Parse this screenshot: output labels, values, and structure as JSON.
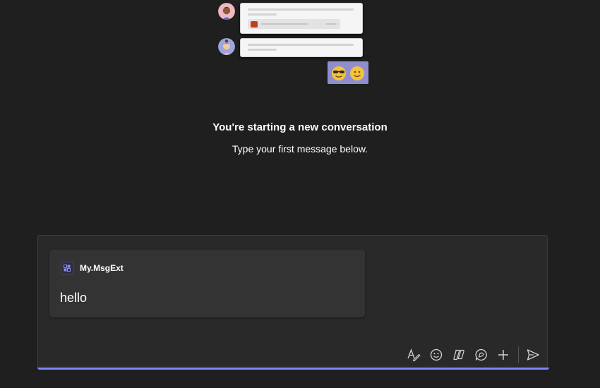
{
  "empty_state": {
    "title": "You're starting a new conversation",
    "subtitle": "Type your first message below."
  },
  "illustration": {
    "emojis": [
      "sunglasses-emoji",
      "smiling-emoji"
    ],
    "bubble_color": "#8f8fcf"
  },
  "compose": {
    "extension_card": {
      "app_name": "My.MsgExt",
      "message": "hello"
    },
    "toolbar": {
      "buttons": [
        "format-icon",
        "emoji-icon",
        "loop-icon",
        "praise-icon",
        "add-icon",
        "send-icon"
      ]
    },
    "accent_color": "#7f85f5"
  }
}
